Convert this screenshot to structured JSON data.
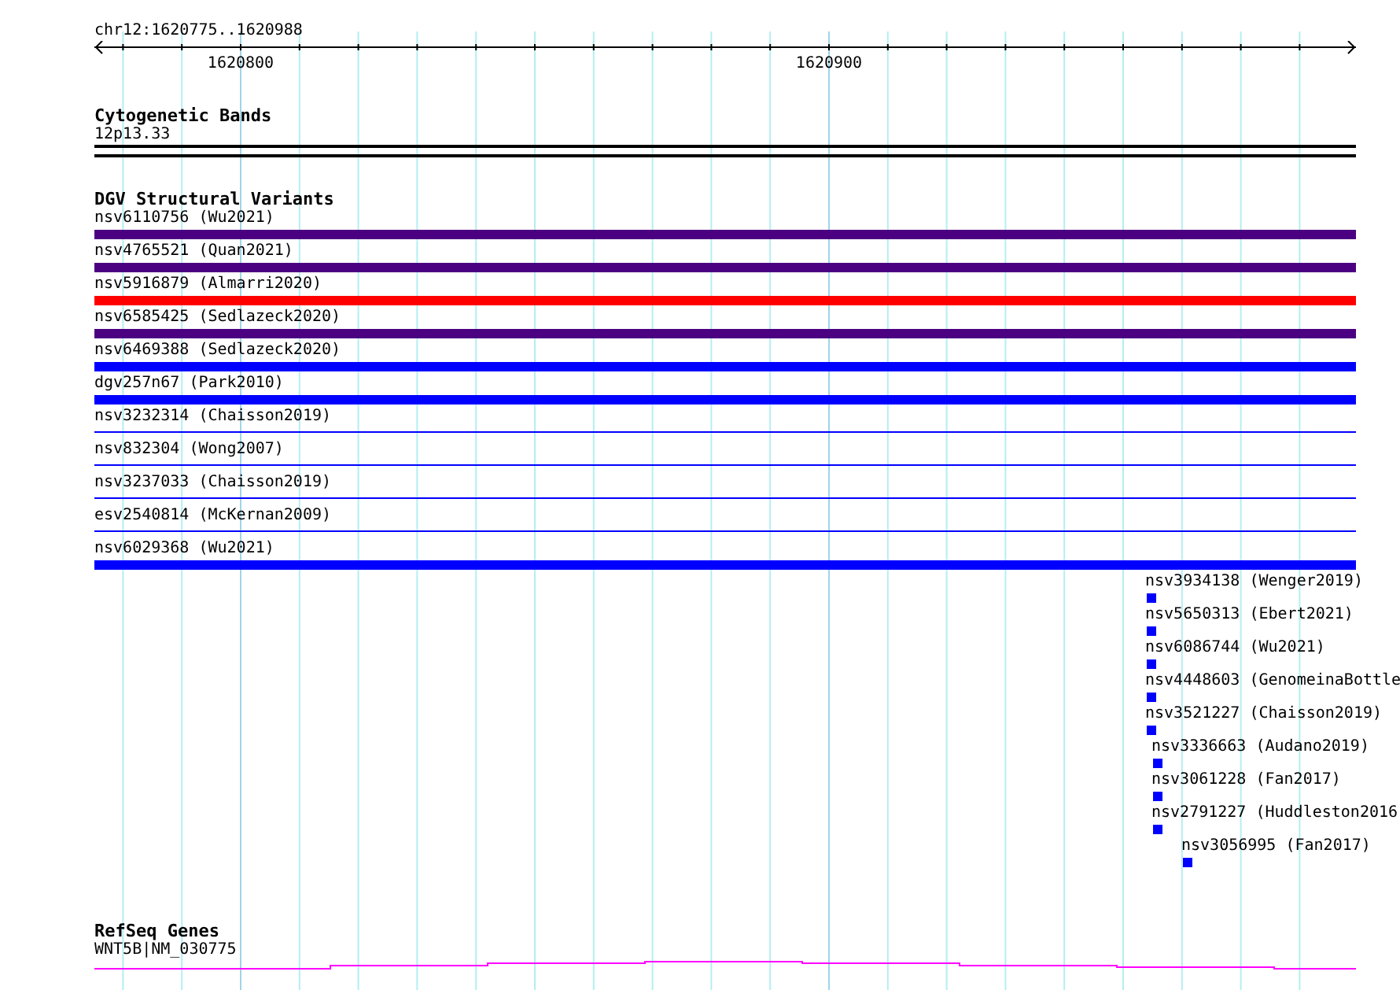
{
  "ruler": {
    "region": "chr12:1620775..1620988",
    "tick_labels": [
      "1620800",
      "1620900"
    ]
  },
  "tracks": [
    {
      "kind": "bands",
      "title": "Cytogenetic Bands",
      "features": [
        {
          "label": "12p13.33"
        }
      ]
    },
    {
      "kind": "variants",
      "title": "DGV Structural Variants",
      "features": [
        {
          "label": "nsv6110756 (Wu2021)",
          "kind": "thick",
          "color": "#4b0082"
        },
        {
          "label": "nsv4765521 (Quan2021)",
          "kind": "thick",
          "color": "#4b0082"
        },
        {
          "label": "nsv5916879 (Almarri2020)",
          "kind": "thick",
          "color": "#ff0000"
        },
        {
          "label": "nsv6585425 (Sedlazeck2020)",
          "kind": "thick",
          "color": "#4b0082"
        },
        {
          "label": "nsv6469388 (Sedlazeck2020)",
          "kind": "thick",
          "color": "#0000ff"
        },
        {
          "label": "dgv257n67 (Park2010)",
          "kind": "thick",
          "color": "#0000ff"
        },
        {
          "label": "nsv3232314 (Chaisson2019)",
          "kind": "thin",
          "color": "#0000ff"
        },
        {
          "label": "nsv832304 (Wong2007)",
          "kind": "thin",
          "color": "#0000ff"
        },
        {
          "label": "nsv3237033 (Chaisson2019)",
          "kind": "thin",
          "color": "#0000ff"
        },
        {
          "label": "esv2540814 (McKernan2009)",
          "kind": "thin",
          "color": "#0000ff"
        },
        {
          "label": "nsv6029368 (Wu2021)",
          "kind": "thick",
          "color": "#0000ff"
        },
        {
          "label": "nsv3934138 (Wenger2019)",
          "kind": "point",
          "color": "#0000ff"
        },
        {
          "label": "nsv5650313 (Ebert2021)",
          "kind": "point",
          "color": "#0000ff"
        },
        {
          "label": "nsv6086744 (Wu2021)",
          "kind": "point",
          "color": "#0000ff"
        },
        {
          "label": "nsv4448603 (GenomeinaBottle",
          "kind": "point",
          "color": "#0000ff"
        },
        {
          "label": "nsv3521227 (Chaisson2019)",
          "kind": "point",
          "color": "#0000ff"
        },
        {
          "label": "nsv3336663 (Audano2019)",
          "kind": "point",
          "color": "#0000ff"
        },
        {
          "label": "nsv3061228 (Fan2017)",
          "kind": "point",
          "color": "#0000ff"
        },
        {
          "label": "nsv2791227 (Huddleston2016",
          "kind": "point",
          "color": "#0000ff"
        },
        {
          "label": "nsv3056995 (Fan2017)",
          "kind": "point",
          "color": "#0000ff"
        }
      ]
    },
    {
      "kind": "genes",
      "title": "RefSeq Genes",
      "features": [
        {
          "label": "WNT5B|NM_030775"
        }
      ]
    }
  ]
}
